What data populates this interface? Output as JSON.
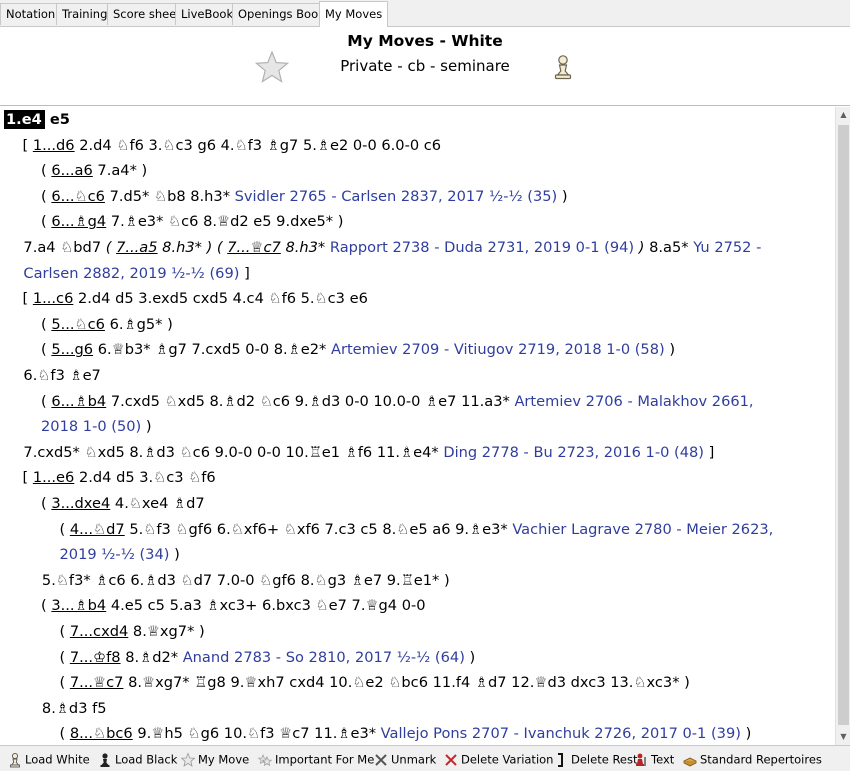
{
  "tabs": [
    "Notation",
    "Training",
    "Score sheet",
    "LiveBook",
    "Openings Book",
    "My Moves"
  ],
  "header": {
    "title": "My Moves - White",
    "subtitle": "Private - cb - seminare"
  },
  "lines": [
    {
      "indent": 0,
      "segs": [
        {
          "t": "1.e4",
          "c": "hl"
        },
        {
          "t": " e5",
          "c": "b"
        }
      ]
    },
    {
      "indent": 1,
      "segs": [
        {
          "t": "[ "
        },
        {
          "t": "1...d6",
          "c": "un"
        },
        {
          "t": " 2.d4  ♘f6  3.♘c3  g6  4.♘f3  ♗g7  5.♗e2  0-0  6.0-0  c6"
        }
      ]
    },
    {
      "indent": 2,
      "segs": [
        {
          "t": "( "
        },
        {
          "t": "6...a6",
          "c": "un"
        },
        {
          "t": "  7.a4* )"
        }
      ]
    },
    {
      "indent": 2,
      "segs": [
        {
          "t": "( "
        },
        {
          "t": "6...♘c6",
          "c": "un"
        },
        {
          "t": "  7.d5*  ♘b8  8.h3* "
        },
        {
          "t": "Svidler 2765 - Carlsen 2837, 2017 ½-½ (35)",
          "c": "gm"
        },
        {
          "t": " )"
        }
      ]
    },
    {
      "indent": 2,
      "segs": [
        {
          "t": "( "
        },
        {
          "t": "6...♗g4",
          "c": "un"
        },
        {
          "t": "  7.♗e3*  ♘c6  8.♕d2  e5  9.dxe5* )"
        }
      ]
    },
    {
      "indent": 1.05,
      "segs": [
        {
          "t": "7.a4  ♘bd7  "
        },
        {
          "t": "( ",
          "c": "it"
        },
        {
          "t": "7...a5",
          "c": "it un"
        },
        {
          "t": "  8.h3* ) ( ",
          "c": "it"
        },
        {
          "t": "7...♕c7",
          "c": "it un"
        },
        {
          "t": "  8.h3*",
          "c": "it"
        },
        {
          "t": " Rapport 2738 - Duda 2731, 2019 0-1 (94)",
          "c": "gm"
        },
        {
          "t": " ) ",
          "c": "it"
        },
        {
          "t": "8.a5* "
        },
        {
          "t": "Yu 2752 -",
          "c": "gm"
        }
      ]
    },
    {
      "indent": 1.05,
      "segs": [
        {
          "t": "Carlsen 2882, 2019 ½-½ (69)",
          "c": "gm"
        },
        {
          "t": " ]"
        }
      ]
    },
    {
      "indent": 1,
      "segs": [
        {
          "t": "[ "
        },
        {
          "t": "1...c6",
          "c": "un"
        },
        {
          "t": "  2.d4  d5  3.exd5  cxd5  4.c4  ♘f6  5.♘c3  e6"
        }
      ]
    },
    {
      "indent": 2,
      "segs": [
        {
          "t": "( "
        },
        {
          "t": "5...♘c6",
          "c": "un"
        },
        {
          "t": "  6.♗g5* )"
        }
      ]
    },
    {
      "indent": 2,
      "segs": [
        {
          "t": "( "
        },
        {
          "t": "5...g6",
          "c": "un"
        },
        {
          "t": "  6.♕b3*  ♗g7  7.cxd5  0-0  8.♗e2* "
        },
        {
          "t": "Artemiev 2709 - Vitiugov 2719, 2018 1-0 (58)",
          "c": "gm"
        },
        {
          "t": " )"
        }
      ]
    },
    {
      "indent": 1.05,
      "segs": [
        {
          "t": "6.♘f3  ♗e7"
        }
      ]
    },
    {
      "indent": 2,
      "segs": [
        {
          "t": "( "
        },
        {
          "t": "6...♗b4",
          "c": "un"
        },
        {
          "t": "  7.cxd5  ♘xd5  8.♗d2  ♘c6  9.♗d3  0-0  10.0-0  ♗e7  11.a3* "
        },
        {
          "t": "Artemiev 2706 - Malakhov 2661,",
          "c": "gm"
        }
      ]
    },
    {
      "indent": 2,
      "segs": [
        {
          "t": "2018 1-0 (50)",
          "c": "gm"
        },
        {
          "t": " )"
        }
      ]
    },
    {
      "indent": 1.05,
      "segs": [
        {
          "t": "7.cxd5*  ♘xd5  8.♗d3  ♘c6  9.0-0  0-0  10.♖e1  ♗f6  11.♗e4* "
        },
        {
          "t": "Ding 2778 - Bu 2723, 2016 1-0 (48)",
          "c": "gm"
        },
        {
          "t": " ]"
        }
      ]
    },
    {
      "indent": 1,
      "segs": [
        {
          "t": "[ "
        },
        {
          "t": "1...e6",
          "c": "un"
        },
        {
          "t": "  2.d4  d5  3.♘c3  ♘f6"
        }
      ]
    },
    {
      "indent": 2,
      "segs": [
        {
          "t": "( "
        },
        {
          "t": "3...dxe4",
          "c": "un"
        },
        {
          "t": "  4.♘xe4  ♗d7"
        }
      ]
    },
    {
      "indent": 3,
      "segs": [
        {
          "t": "( "
        },
        {
          "t": "4...♘d7",
          "c": "un"
        },
        {
          "t": "  5.♘f3  ♘gf6  6.♘xf6+  ♘xf6  7.c3  c5  8.♘e5  a6  9.♗e3* "
        },
        {
          "t": "Vachier Lagrave 2780 - Meier 2623,",
          "c": "gm"
        }
      ]
    },
    {
      "indent": 3,
      "segs": [
        {
          "t": "2019 ½-½ (34)",
          "c": "gm"
        },
        {
          "t": " )"
        }
      ]
    },
    {
      "indent": 2.05,
      "segs": [
        {
          "t": "5.♘f3*  ♗c6  6.♗d3  ♘d7  7.0-0  ♘gf6  8.♘g3  ♗e7  9.♖e1* )"
        }
      ]
    },
    {
      "indent": 2,
      "segs": [
        {
          "t": "( "
        },
        {
          "t": "3...♗b4",
          "c": "un"
        },
        {
          "t": "  4.e5  c5  5.a3  ♗xc3+  6.bxc3  ♘e7  7.♕g4  0-0"
        }
      ]
    },
    {
      "indent": 3,
      "segs": [
        {
          "t": "( "
        },
        {
          "t": "7...cxd4",
          "c": "un"
        },
        {
          "t": "  8.♕xg7* )"
        }
      ]
    },
    {
      "indent": 3,
      "segs": [
        {
          "t": "( "
        },
        {
          "t": "7...♔f8",
          "c": "un"
        },
        {
          "t": "  8.♗d2* "
        },
        {
          "t": "Anand 2783 - So 2810, 2017 ½-½ (64)",
          "c": "gm"
        },
        {
          "t": " )"
        }
      ]
    },
    {
      "indent": 3,
      "segs": [
        {
          "t": "( "
        },
        {
          "t": "7...♕c7",
          "c": "un"
        },
        {
          "t": "  8.♕xg7*  ♖g8  9.♕xh7  cxd4  10.♘e2  ♘bc6  11.f4  ♗d7  12.♕d3  dxc3  13.♘xc3* )"
        }
      ]
    },
    {
      "indent": 2.05,
      "segs": [
        {
          "t": "8.♗d3  f5"
        }
      ]
    },
    {
      "indent": 3,
      "segs": [
        {
          "t": "( "
        },
        {
          "t": "8...♘bc6",
          "c": "un"
        },
        {
          "t": "  9.♕h5  ♘g6  10.♘f3  ♕c7  11.♗e3* "
        },
        {
          "t": "Vallejo Pons 2707 - Ivanchuk 2726, 2017 0-1 (39)",
          "c": "gm"
        },
        {
          "t": " )"
        }
      ]
    }
  ],
  "toolbar": [
    {
      "label": "Load White",
      "icon": "white-pawn-icon"
    },
    {
      "label": "Load Black",
      "icon": "black-pawn-icon"
    },
    {
      "label": "My Move",
      "icon": "star-icon"
    },
    {
      "label": "Important For Me",
      "icon": "double-star-icon"
    },
    {
      "label": "Unmark",
      "icon": "unmark-icon"
    },
    {
      "label": "Delete Variation",
      "icon": "delete-variation-icon"
    },
    {
      "label": "Delete Rest",
      "icon": "delete-rest-icon"
    },
    {
      "label": "Text",
      "icon": "text-icon"
    },
    {
      "label": "Standard Repertoires",
      "icon": "repertoire-book-icon"
    }
  ]
}
